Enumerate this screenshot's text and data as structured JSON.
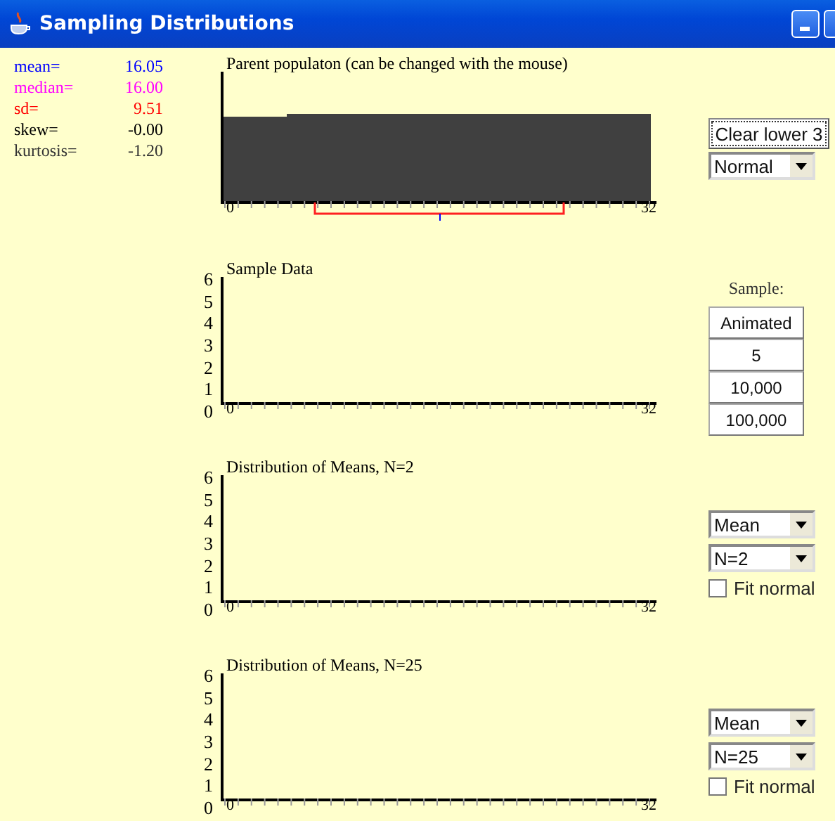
{
  "window": {
    "title": "Sampling Distributions"
  },
  "stats": [
    {
      "label": "mean=",
      "value": "16.05",
      "color": "#0000ff"
    },
    {
      "label": "median=",
      "value": "16.00",
      "color": "#ff00ff"
    },
    {
      "label": "sd=",
      "value": "9.51",
      "color": "#ff0000"
    },
    {
      "label": "skew=",
      "value": "-0.00",
      "color": "#000000"
    },
    {
      "label": "kurtosis=",
      "value": "-1.20",
      "color": "#333333"
    }
  ],
  "panels": [
    {
      "kind": "population",
      "title": "Parent populaton (can be changed with the mouse)",
      "x_labels": [
        "0",
        "32"
      ],
      "controls": [
        {
          "kind": "button",
          "label": "Clear lower 3",
          "focused": true
        },
        {
          "kind": "dropdown",
          "value": "Normal"
        }
      ]
    },
    {
      "kind": "histogram",
      "title": "Sample Data",
      "y_labels": [
        "6",
        "5",
        "4",
        "3",
        "2",
        "1",
        "0"
      ],
      "x_labels": [
        "0",
        "32"
      ],
      "controls": [
        {
          "kind": "heading",
          "label": "Sample:"
        },
        {
          "kind": "stack_button",
          "label": "Animated"
        },
        {
          "kind": "stack_button",
          "label": "5"
        },
        {
          "kind": "stack_button",
          "label": "10,000"
        },
        {
          "kind": "stack_button",
          "label": "100,000"
        }
      ]
    },
    {
      "kind": "histogram",
      "title": "Distribution of Means, N=2",
      "y_labels": [
        "6",
        "5",
        "4",
        "3",
        "2",
        "1",
        "0"
      ],
      "x_labels": [
        "0",
        "32"
      ],
      "controls": [
        {
          "kind": "dropdown",
          "value": "Mean"
        },
        {
          "kind": "dropdown",
          "value": "N=2"
        },
        {
          "kind": "checkbox",
          "label": "Fit normal",
          "checked": false
        }
      ]
    },
    {
      "kind": "histogram",
      "title": "Distribution of Means, N=25",
      "y_labels": [
        "6",
        "5",
        "4",
        "3",
        "2",
        "1",
        "0"
      ],
      "x_labels": [
        "0",
        "32"
      ],
      "controls": [
        {
          "kind": "dropdown",
          "value": "Mean"
        },
        {
          "kind": "dropdown",
          "value": "N=25"
        },
        {
          "kind": "checkbox",
          "label": "Fit normal",
          "checked": false
        }
      ]
    }
  ]
}
